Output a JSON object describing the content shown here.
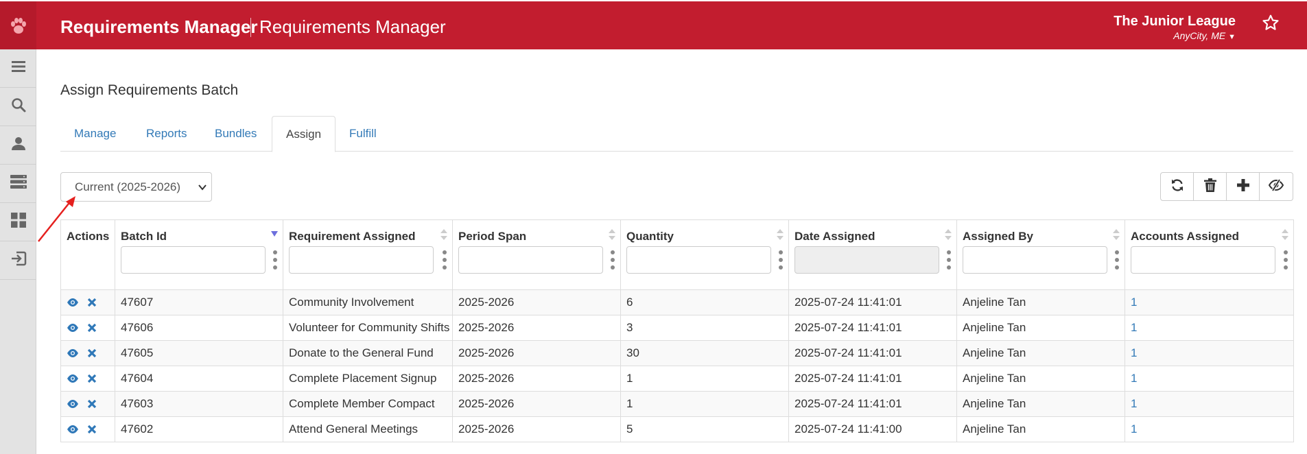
{
  "header": {
    "title": "Requirements Manager",
    "subtitle": "Requirements Manager",
    "org_name": "The Junior League",
    "org_location": "AnyCity, ME",
    "brand_color": "#c21d2f"
  },
  "sidebar": {
    "items": [
      {
        "icon": "menu-icon"
      },
      {
        "icon": "search-icon"
      },
      {
        "icon": "user-icon"
      },
      {
        "icon": "server-icon"
      },
      {
        "icon": "dashboard-icon"
      },
      {
        "icon": "sign-out-icon"
      }
    ]
  },
  "page": {
    "title": "Assign Requirements Batch"
  },
  "tabs": [
    {
      "label": "Manage",
      "active": false
    },
    {
      "label": "Reports",
      "active": false
    },
    {
      "label": "Bundles",
      "active": false
    },
    {
      "label": "Assign",
      "active": true
    },
    {
      "label": "Fulfill",
      "active": false
    }
  ],
  "period_select": {
    "value": "Current (2025-2026)"
  },
  "toolbar": {
    "buttons": [
      "refresh-icon",
      "trash-icon",
      "plus-icon",
      "eye-slash-icon"
    ]
  },
  "table": {
    "columns": [
      "Actions",
      "Batch Id",
      "Requirement Assigned",
      "Period Span",
      "Quantity",
      "Date Assigned",
      "Assigned By",
      "Accounts Assigned"
    ],
    "rows": [
      {
        "batch_id": "47607",
        "requirement": "Community Involvement",
        "period": "2025-2026",
        "quantity": "6",
        "date": "2025-07-24 11:41:01",
        "assigned_by": "Anjeline Tan",
        "accounts": "1"
      },
      {
        "batch_id": "47606",
        "requirement": "Volunteer for Community Shifts",
        "period": "2025-2026",
        "quantity": "3",
        "date": "2025-07-24 11:41:01",
        "assigned_by": "Anjeline Tan",
        "accounts": "1"
      },
      {
        "batch_id": "47605",
        "requirement": "Donate to the General Fund",
        "period": "2025-2026",
        "quantity": "30",
        "date": "2025-07-24 11:41:01",
        "assigned_by": "Anjeline Tan",
        "accounts": "1"
      },
      {
        "batch_id": "47604",
        "requirement": "Complete Placement Signup",
        "period": "2025-2026",
        "quantity": "1",
        "date": "2025-07-24 11:41:01",
        "assigned_by": "Anjeline Tan",
        "accounts": "1"
      },
      {
        "batch_id": "47603",
        "requirement": "Complete Member Compact",
        "period": "2025-2026",
        "quantity": "1",
        "date": "2025-07-24 11:41:01",
        "assigned_by": "Anjeline Tan",
        "accounts": "1"
      },
      {
        "batch_id": "47602",
        "requirement": "Attend General Meetings",
        "period": "2025-2026",
        "quantity": "5",
        "date": "2025-07-24 11:41:00",
        "assigned_by": "Anjeline Tan",
        "accounts": "1"
      }
    ]
  }
}
